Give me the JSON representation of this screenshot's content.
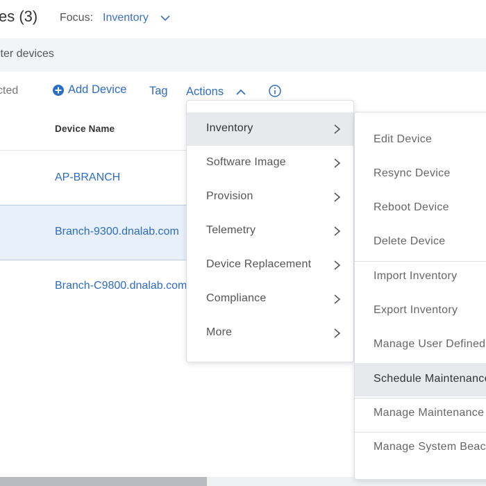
{
  "header": {
    "title": "es (3)",
    "focus_label": "Focus:",
    "focus_value": "Inventory"
  },
  "filter": {
    "placeholder": "lter devices"
  },
  "toolbar": {
    "selected_label": "cted",
    "add_device_label": "Add Device",
    "tag_label": "Tag",
    "actions_label": "Actions"
  },
  "table": {
    "columns": [
      "Device Name"
    ],
    "rows": [
      {
        "device_name": "AP-BRANCH"
      },
      {
        "device_name": "Branch-9300.dnalab.com"
      },
      {
        "device_name": "Branch-C9800.dnalab.com"
      }
    ]
  },
  "actions_menu": {
    "items": [
      {
        "label": "Inventory"
      },
      {
        "label": "Software Image"
      },
      {
        "label": "Provision"
      },
      {
        "label": "Telemetry"
      },
      {
        "label": "Device Replacement"
      },
      {
        "label": "Compliance"
      },
      {
        "label": "More"
      }
    ]
  },
  "inventory_submenu": {
    "items": [
      {
        "label": "Edit Device"
      },
      {
        "label": "Resync Device"
      },
      {
        "label": "Reboot Device"
      },
      {
        "label": "Delete Device"
      },
      {
        "label": "Import Inventory"
      },
      {
        "label": "Export Inventory"
      },
      {
        "label": "Manage User Defined Fields"
      },
      {
        "label": "Schedule Maintenance"
      },
      {
        "label": "Manage Maintenance"
      },
      {
        "label": "Manage System Beacon"
      }
    ]
  },
  "colors": {
    "link": "#2d6cc6",
    "selected_row": "#e8f0fb",
    "menu_hover": "#e7e9ec"
  }
}
